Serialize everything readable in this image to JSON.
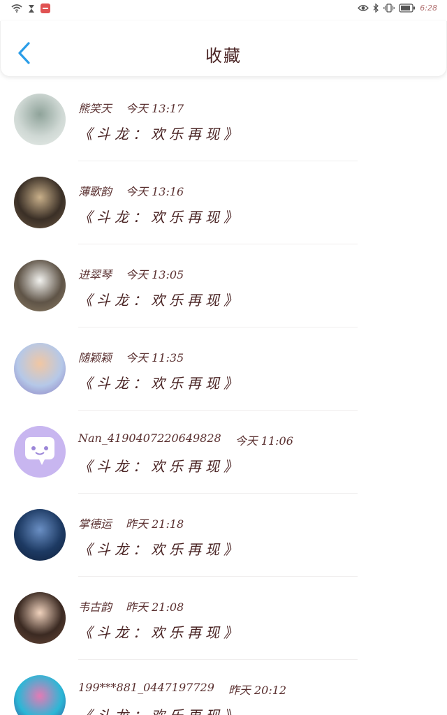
{
  "status_bar": {
    "time": "6:28",
    "icons": [
      "wifi-icon",
      "hourglass-icon",
      "notification-badge-icon",
      "eye-icon",
      "bluetooth-icon",
      "vibrate-icon",
      "battery-icon"
    ]
  },
  "header": {
    "title": "收藏",
    "back_icon": "chevron-left-icon",
    "accent": "#2a9de8"
  },
  "items": [
    {
      "name": "熊笑天",
      "time": "今天 13:17",
      "title": "《斗龙：欢乐再现》",
      "avatar_colors": [
        "#cfd8d4",
        "#8fa39a",
        "#e9eeea"
      ]
    },
    {
      "name": "薄歌韵",
      "time": "今天 13:16",
      "title": "《斗龙：欢乐再现》",
      "avatar_colors": [
        "#3a2f26",
        "#c9b08a",
        "#6e5a44"
      ]
    },
    {
      "name": "进翠琴",
      "time": "今天 13:05",
      "title": "《斗龙：欢乐再现》",
      "avatar_colors": [
        "#5f5447",
        "#f2f2ef",
        "#8e7e66"
      ]
    },
    {
      "name": "随颖颖",
      "time": "今天 11:35",
      "title": "《斗龙：欢乐再现》",
      "avatar_colors": [
        "#b5c8e8",
        "#f1c7a3",
        "#8a7cc0"
      ]
    },
    {
      "name": "Nan_4190407220649828",
      "time": "今天 11:06",
      "title": "《斗龙：欢乐再现》",
      "avatar_colors": [
        "#c8b6f0",
        "#ffffff",
        "#9b86d8"
      ]
    },
    {
      "name": "掌德运",
      "time": "昨天 21:18",
      "title": "《斗龙：欢乐再现》",
      "avatar_colors": [
        "#1d3a63",
        "#6a8fc4",
        "#0f1f3a"
      ]
    },
    {
      "name": "韦古韵",
      "time": "昨天 21:08",
      "title": "《斗龙：欢乐再现》",
      "avatar_colors": [
        "#3b2a22",
        "#f0d2bd",
        "#6b4a3a"
      ]
    },
    {
      "name": "199***881_0447197729",
      "time": "昨天 20:12",
      "title": "《斗龙：欢乐再现》",
      "avatar_colors": [
        "#2bb7d6",
        "#e47ab5",
        "#3a3f8a"
      ]
    }
  ]
}
